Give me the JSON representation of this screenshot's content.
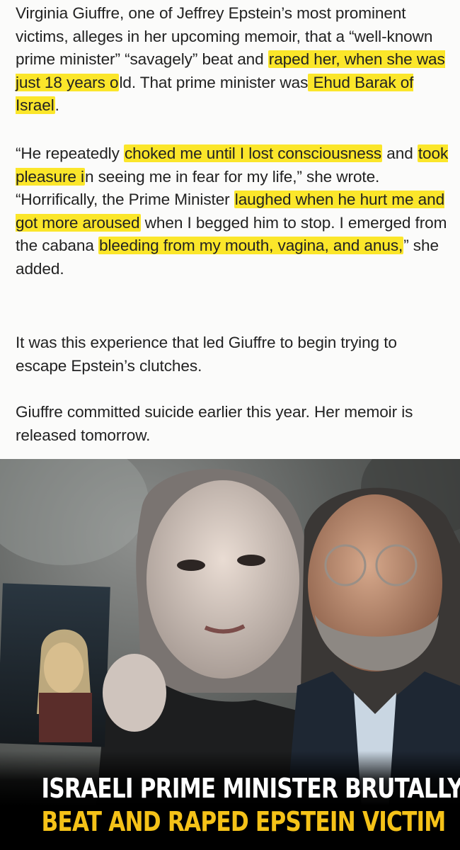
{
  "article": {
    "p1": [
      {
        "t": "Virginia Giuffre, one of Jeffrey Epstein’s most prominent victims, alleges in her upcoming memoir, that a “well-known prime minister” “savagely” beat and ",
        "h": false
      },
      {
        "t": "raped her, when she was just 18 years o",
        "h": true
      },
      {
        "t": "ld. That prime minister was",
        "h": false
      },
      {
        "t": " Ehud Barak of Israel",
        "h": true
      },
      {
        "t": ".",
        "h": false
      }
    ],
    "p2": [
      {
        "t": "“He repeatedly ",
        "h": false
      },
      {
        "t": "choked me until I lost consciousness",
        "h": true
      },
      {
        "t": " and ",
        "h": false
      },
      {
        "t": "took pleasure i",
        "h": true
      },
      {
        "t": "n seeing me in fear for my life,” she wrote. “Horrifically, the Prime Minister ",
        "h": false
      },
      {
        "t": "laughed when he hurt me and got more aroused",
        "h": true
      },
      {
        "t": " when I begged him to stop. I emerged from the cabana ",
        "h": false
      },
      {
        "t": "bleeding from my mouth, vagina, and anus,",
        "h": true
      },
      {
        "t": "” she added.",
        "h": false
      }
    ],
    "p3": "It was this experience that led Giuffre to begin trying to escape Epstein’s clutches.",
    "p4": "Giuffre committed suicide earlier this year. Her memoir is released tomorrow."
  },
  "graphic": {
    "headline_line1": "ISRAELI PRIME MINISTER BRUTALLY",
    "headline_line2": "BEAT AND RAPED EPSTEIN VICTIM"
  },
  "colors": {
    "highlight": "#fbe62a",
    "headline_white": "#ffffff",
    "headline_yellow": "#f5c218"
  }
}
